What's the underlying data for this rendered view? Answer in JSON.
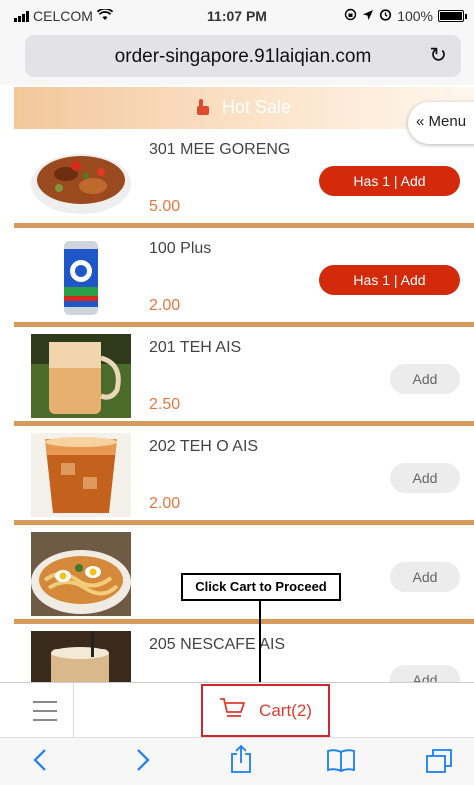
{
  "status_bar": {
    "carrier": "CELCOM",
    "time": "11:07 PM",
    "battery": "100%",
    "icons": [
      "signal-icon",
      "wifi-icon",
      "lock-rotation-icon",
      "location-icon",
      "alarm-icon",
      "battery-icon"
    ]
  },
  "browser": {
    "url": "order-singapore.91laiqian.com",
    "reload_icon": "↻"
  },
  "category": {
    "title": "Hot Sale",
    "icon": "thumb-icon"
  },
  "menu_button": {
    "label": "« Menu"
  },
  "items": [
    {
      "name": "301 MEE GORENG",
      "price": "5.00",
      "button": "Has 1 | Add"
    },
    {
      "name": "100 Plus",
      "price": "2.00",
      "button": "Has 1 | Add"
    },
    {
      "name": "201 TEH AIS",
      "price": "2.50",
      "button": "Add"
    },
    {
      "name": "202 TEH O AIS",
      "price": "2.00",
      "button": "Add"
    },
    {
      "name": "",
      "price": "",
      "button": "Add"
    },
    {
      "name": "205 NESCAFE AIS",
      "price": "",
      "button": "Add"
    }
  ],
  "annotation": {
    "text": "Click Cart to Proceed"
  },
  "cart": {
    "label": "Cart(2)"
  },
  "colors": {
    "accent": "#d32a0c",
    "price": "#e8763f",
    "divider": "#d69a5c",
    "safari_blue": "#1a7ef5"
  }
}
